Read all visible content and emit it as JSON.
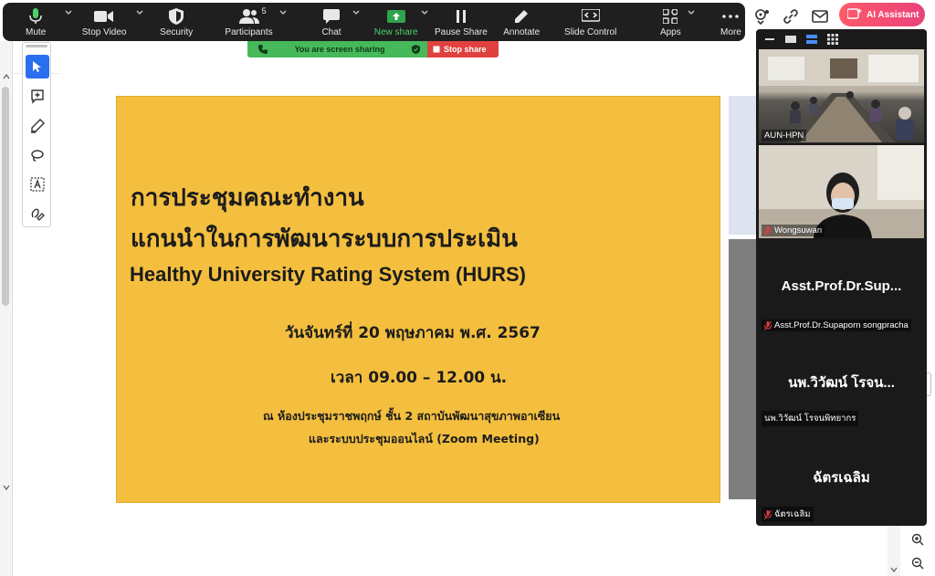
{
  "toolbar": {
    "items": [
      {
        "key": "mute",
        "label": "Mute"
      },
      {
        "key": "stop_video",
        "label": "Stop Video"
      },
      {
        "key": "security",
        "label": "Security"
      },
      {
        "key": "participants",
        "label": "Participants",
        "count": "5"
      },
      {
        "key": "chat",
        "label": "Chat"
      },
      {
        "key": "new_share",
        "label": "New share"
      },
      {
        "key": "pause_share",
        "label": "Pause Share"
      },
      {
        "key": "annotate",
        "label": "Annotate"
      },
      {
        "key": "slide_control",
        "label": "Slide Control"
      },
      {
        "key": "apps",
        "label": "Apps"
      },
      {
        "key": "more",
        "label": "More"
      }
    ],
    "ai_assistant": "AI Assistant"
  },
  "share_banner": {
    "status": "You are screen sharing",
    "stop": "Stop share"
  },
  "slide": {
    "title_line1": "การประชุมคณะทำงาน",
    "title_line2": "แกนนำในการพัฒนาระบบการประเมิน",
    "title_line3": "Healthy University Rating System (HURS)",
    "date": "วันจันทร์ที่ 20 พฤษภาคม พ.ศ. 2567",
    "time": "เวลา 09.00 – 12.00 น.",
    "place_line1": "ณ ห้องประชุมราชพฤกษ์ ชั้น 2 สถาบันพัฒนาสุขภาพอาเซียน",
    "place_line2": "และระบบประชุมออนไลน์ (Zoom Meeting)",
    "background_color": "#f4bf3f"
  },
  "gallery": {
    "participants": [
      {
        "name": "AUN-HPN",
        "display": "",
        "muted": false,
        "video": true
      },
      {
        "name": "Wongsuwan",
        "display": "",
        "muted": true,
        "video": true
      },
      {
        "name": "Asst.Prof.Dr.Supaporn songpracha",
        "display": "Asst.Prof.Dr.Sup...",
        "muted": true,
        "video": false
      },
      {
        "name": "นพ.วิวัฒน์ โรจนพิทยากร",
        "display": "นพ.วิวัฒน์ โรจน...",
        "muted": false,
        "video": false
      },
      {
        "name": "ฉัตรเฉลิม",
        "display": "ฉัตรเฉลิม",
        "muted": true,
        "video": false
      }
    ]
  },
  "colors": {
    "toolbar_bg": "#1f1f1f",
    "share_green": "#46b95a",
    "share_red": "#e0413f",
    "accent_blue": "#2a6ff0",
    "ai_gradient_start": "#ff5a6a"
  }
}
